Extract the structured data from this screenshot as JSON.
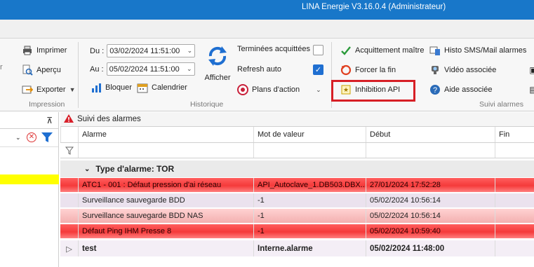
{
  "window": {
    "title": "LINA Energie  V3.16.0.4  (Administrateur)"
  },
  "ribbon": {
    "impression": {
      "label": "Impression",
      "imprimer": "Imprimer",
      "apercu": "Aperçu",
      "exporter": "Exporter"
    },
    "historique": {
      "label": "Historique",
      "du_label": "Du :",
      "du_value": "03/02/2024 11:51:00",
      "au_label": "Au :",
      "au_value": "05/02/2024 11:51:00",
      "bloquer": "Bloquer",
      "calendrier": "Calendrier",
      "afficher": "Afficher",
      "terminees": "Terminées acquittées",
      "terminees_checked": false,
      "refresh": "Refresh auto",
      "refresh_checked": true,
      "plans": "Plans d'action"
    },
    "suivi": {
      "label": "Suivi alarmes",
      "acquittement": "Acquittement maître",
      "forcer": "Forcer la fin",
      "inhibition": "Inhibition API",
      "histo": "Histo SMS/Mail alarmes",
      "video": "Vidéo associée",
      "aide": "Aide associée"
    }
  },
  "grid": {
    "title": "Suivi des alarmes",
    "columns": [
      "Alarme",
      "Mot de valeur",
      "Début",
      "Fin"
    ],
    "group_label": "Type d'alarme: TOR",
    "rows": [
      {
        "alarme": "ATC1 - 001 : Défaut pression d'ai réseau",
        "mot": "API_Autoclave_1.DB503.DBX...",
        "debut": "27/01/2024 17:52:28",
        "fin": ""
      },
      {
        "alarme": "Surveillance sauvegarde BDD",
        "mot": "-1",
        "debut": "05/02/2024 10:56:14",
        "fin": ""
      },
      {
        "alarme": "Surveillance sauvegarde BDD NAS",
        "mot": "-1",
        "debut": "05/02/2024 10:56:14",
        "fin": ""
      },
      {
        "alarme": "Défaut Ping IHM Presse 8",
        "mot": "-1",
        "debut": "05/02/2024 10:59:40",
        "fin": ""
      },
      {
        "alarme": "test",
        "mot": "Interne.alarme",
        "debut": "05/02/2024 11:48:00",
        "fin": ""
      }
    ]
  },
  "colors": {
    "titlebar": "#1877c9",
    "highlight": "#d71f26",
    "alarm_red": "#f53a3a",
    "checkbox_on": "#1f6fd1"
  }
}
